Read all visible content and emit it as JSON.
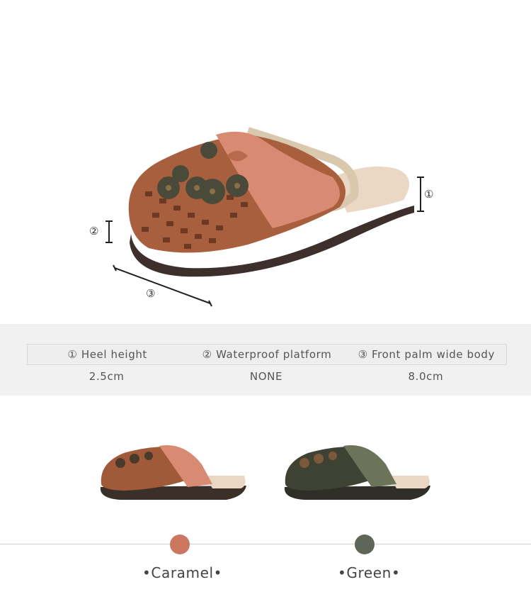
{
  "dimension_markers": [
    "①",
    "②",
    "③"
  ],
  "specs": {
    "headers": [
      "① Heel height",
      "② Waterproof platform",
      "③ Front palm wide body"
    ],
    "values": [
      "2.5cm",
      "NONE",
      "8.0cm"
    ]
  },
  "colors": [
    {
      "label": "•Caramel•",
      "hex": "#cc7860"
    },
    {
      "label": "•Green•",
      "hex": "#5f6657"
    }
  ]
}
